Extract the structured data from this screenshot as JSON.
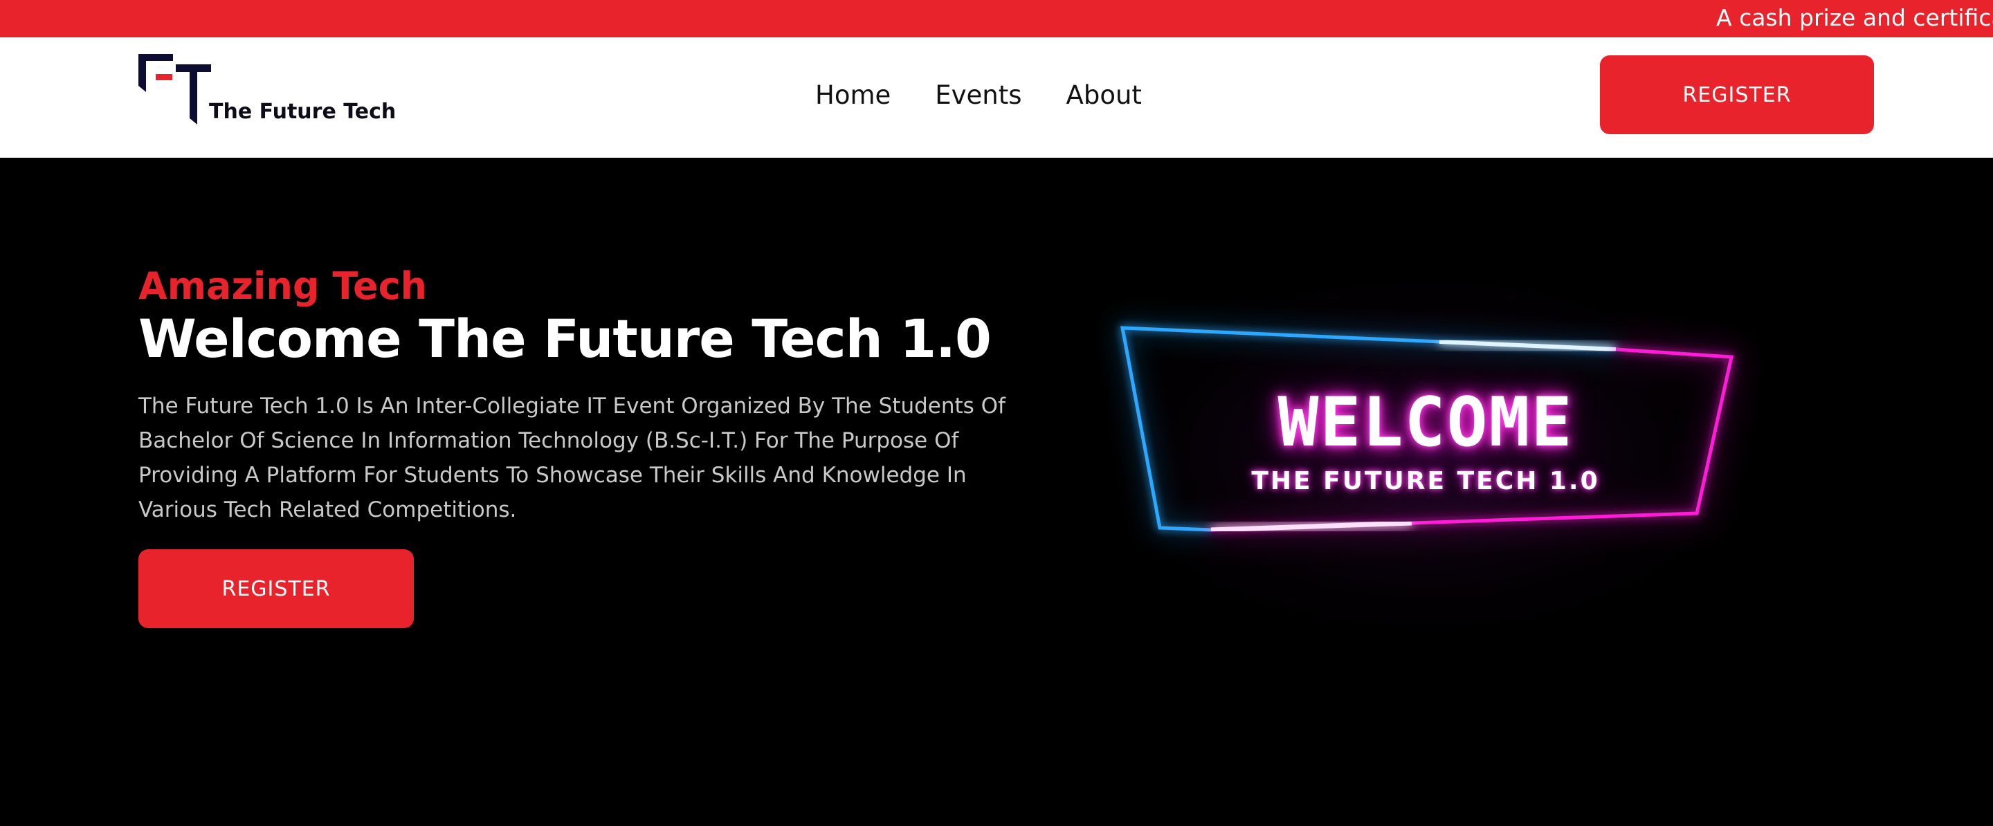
{
  "announcement": {
    "text": "A cash prize and certifica"
  },
  "header": {
    "logo_text": "The Future Tech",
    "nav": [
      {
        "label": "Home"
      },
      {
        "label": "Events"
      },
      {
        "label": "About"
      }
    ],
    "register_label": "REGISTER"
  },
  "hero": {
    "kicker": "Amazing Tech",
    "title": "Welcome The Future Tech 1.0",
    "description": "The Future Tech 1.0 Is An Inter-Collegiate IT Event Organized By The Students Of Bachelor Of Science In Information Technology (B.Sc-I.T.) For The Purpose Of Providing A Platform For Students To Showcase Their Skills And Knowledge In Various Tech Related Competitions.",
    "register_label": "REGISTER",
    "banner": {
      "word": "WELCOME",
      "subtitle": "THE FUTURE TECH 1.0"
    }
  },
  "colors": {
    "accent": "#e8232b",
    "logo_dark": "#0d0d33",
    "neon_blue": "#2fa8ff",
    "neon_pink": "#ff1fd8"
  },
  "icons": [
    "logo-ft-mark"
  ]
}
